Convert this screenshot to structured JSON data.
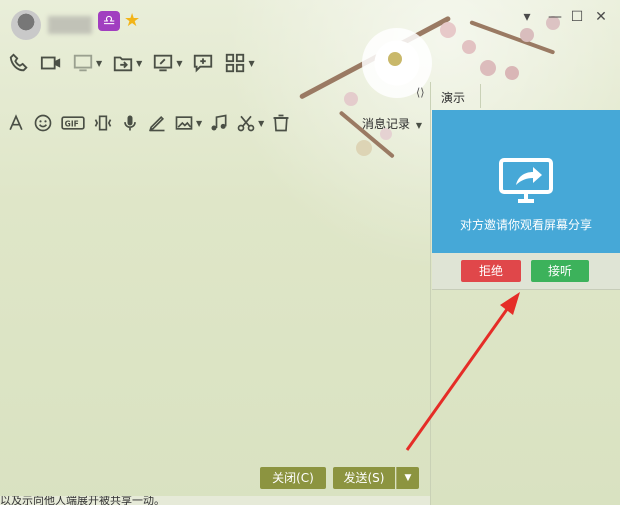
{
  "window_controls": {
    "minimize_icon": "minimize-icon",
    "maximize_icon": "maximize-icon",
    "close_icon": "close-icon"
  },
  "toolbar_top": [
    "phone-icon",
    "video-icon",
    "remote-assist-icon",
    "file-transfer-icon",
    "screen-share-icon",
    "add-contact-icon",
    "apps-icon"
  ],
  "toolbar_input": [
    "font-icon",
    "emoji-icon",
    "gif-icon",
    "shake-icon",
    "voice-icon",
    "handwrite-icon",
    "image-icon",
    "music-icon",
    "screenshot-icon",
    "delete-icon"
  ],
  "message_record": {
    "label": "消息记录"
  },
  "side_panel": {
    "tab_label": "演示",
    "share_text": "对方邀请你观看屏幕分享",
    "reject_label": "拒绝",
    "accept_label": "接听",
    "card_color": "#46a8d7"
  },
  "footer": {
    "close_label": "关闭(C)",
    "send_label": "发送(S)"
  },
  "bottom_text": "以及示向他人端展开被共享一动。",
  "colors": {
    "accent_olive": "#8c9440",
    "reject_red": "#e0474a",
    "accept_green": "#3cb25b",
    "arrow_red": "#e52d27"
  }
}
